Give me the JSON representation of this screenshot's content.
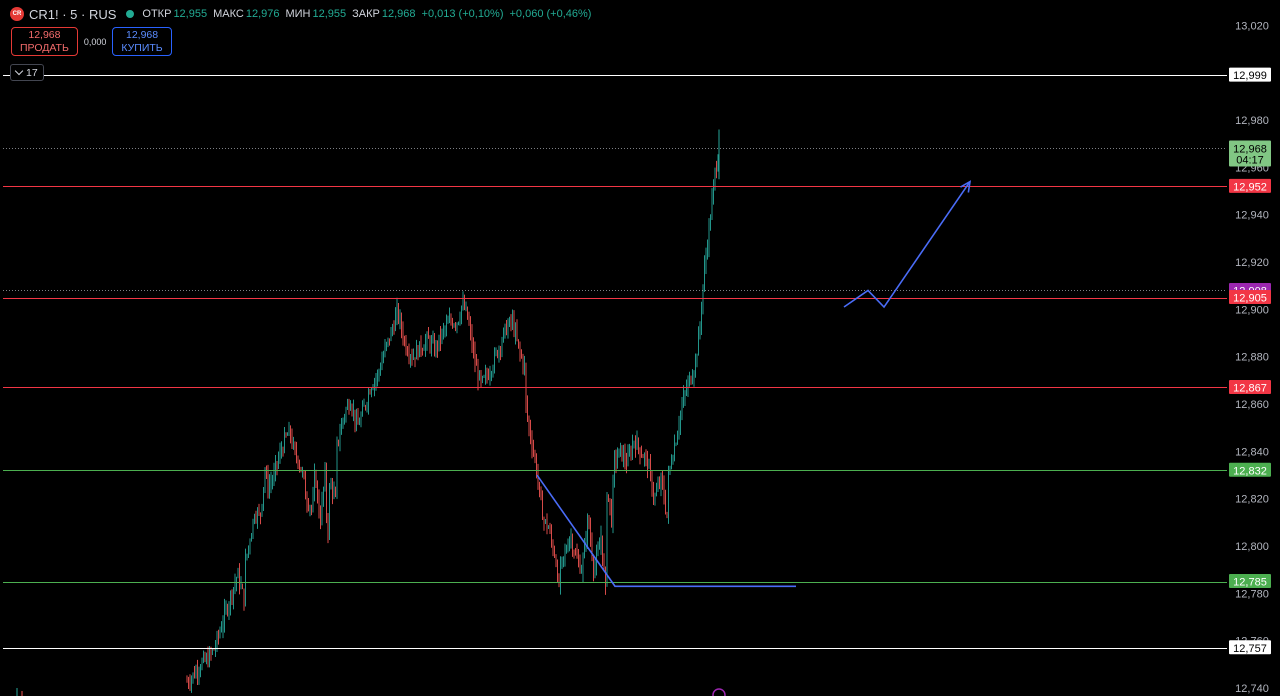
{
  "header": {
    "symbol": "CR1! · 5 · RUS",
    "logo_text": "CR",
    "o_label": "ОТКР",
    "o_value": "12,955",
    "h_label": "МАКС",
    "h_value": "12,976",
    "l_label": "МИН",
    "l_value": "12,955",
    "c_label": "ЗАКР",
    "c_value": "12,968",
    "change": "+0,013 (+0,10%)",
    "change2": "+0,060 (+0,46%)",
    "status_color": "#22ab94"
  },
  "trade": {
    "sell_price": "12,968",
    "sell_label": "ПРОДАТЬ",
    "spread": "0,000",
    "buy_price": "12,968",
    "buy_label": "КУПИТЬ"
  },
  "indicators_toggle": {
    "count": "17"
  },
  "chart_data": {
    "type": "candlestick",
    "symbol": "CR1!",
    "interval": "5",
    "y_axis": {
      "ylim": [
        12.74,
        13.03
      ],
      "ticks": [
        "13,020",
        "12,980",
        "12,960",
        "12,940",
        "12,920",
        "12,900",
        "12,880",
        "12,860",
        "12,840",
        "12,820",
        "12,800",
        "12,780",
        "12,760",
        "12,740"
      ]
    },
    "price_lines": [
      {
        "value": "12,999",
        "color": "#ffffff",
        "label_bg": "#ffffff",
        "label_fg": "#000000"
      },
      {
        "value": "12,952",
        "color": "#f23645",
        "label_bg": "#f23645",
        "label_fg": "#ffffff"
      },
      {
        "value": "12,908",
        "color": "#b3a6c8",
        "label_bg": "#9c27b0",
        "label_fg": "#ffffff",
        "dotted": true
      },
      {
        "value": "12,905",
        "color": "#f23645",
        "label_bg": "#f23645",
        "label_fg": "#ffffff"
      },
      {
        "value": "12,867",
        "color": "#f23645",
        "label_bg": "#f23645",
        "label_fg": "#ffffff"
      },
      {
        "value": "12,832",
        "color": "#4caf50",
        "label_bg": "#4caf50",
        "label_fg": "#ffffff"
      },
      {
        "value": "12,785",
        "color": "#4caf50",
        "label_bg": "#4caf50",
        "label_fg": "#ffffff"
      },
      {
        "value": "12,757",
        "color": "#ffffff",
        "label_bg": "#ffffff",
        "label_fg": "#000000"
      }
    ],
    "last_price": {
      "value": "12,968",
      "countdown": "04:17",
      "bg": "#81c784",
      "fg": "#000000"
    },
    "price_path": [
      [
        12.742,
        12.745,
        12.75,
        12.752,
        12.757,
        12.768,
        12.778,
        12.788,
        12.776
      ],
      [
        12.792,
        12.815,
        12.832,
        12.83,
        12.845,
        12.838,
        12.826,
        12.832,
        12.83,
        12.82
      ],
      [
        12.812,
        12.825,
        12.832,
        12.842,
        12.848,
        12.838,
        12.822,
        12.815,
        12.81,
        12.802,
        12.81
      ],
      [
        12.828,
        12.842,
        12.855,
        12.862,
        12.85,
        12.858,
        12.868,
        12.872,
        12.882,
        12.89,
        12.9
      ],
      [
        12.898,
        12.885,
        12.88,
        12.884,
        12.887,
        12.883,
        12.89,
        12.895,
        12.895,
        12.9
      ],
      [
        12.902,
        12.895,
        12.878,
        12.868,
        12.872,
        12.878,
        12.885,
        12.892,
        12.895,
        12.883,
        12.875
      ],
      [
        12.862,
        12.85,
        12.842,
        12.832,
        12.818,
        12.81,
        12.808,
        12.8,
        12.795,
        12.79
      ],
      [
        12.778,
        12.795,
        12.805,
        12.795,
        12.79,
        12.812,
        12.79,
        12.8,
        12.778,
        12.81
      ],
      [
        12.81,
        12.825,
        12.835,
        12.84,
        12.835,
        12.845,
        12.84,
        12.835,
        12.82,
        12.828,
        12.81
      ],
      [
        12.828,
        12.838,
        12.845,
        12.855,
        12.862,
        12.868,
        12.872,
        12.878,
        12.89,
        12.912,
        12.928,
        12.942,
        12.958,
        12.968
      ]
    ],
    "annotations": [
      {
        "type": "polyline",
        "color": "#4a6cf7",
        "points": [
          [
            12.83,
            12.783
          ],
          [
            12.783,
            12.893
          ]
        ],
        "arrow": true
      },
      {
        "type": "polyline",
        "color": "#4a6cf7",
        "points": [
          [
            12.901,
            12.908,
            12.901,
            12.954
          ]
        ],
        "arrow": true
      }
    ],
    "grid": false,
    "colors": {
      "up": "#26a69a",
      "down": "#ef5350"
    }
  }
}
